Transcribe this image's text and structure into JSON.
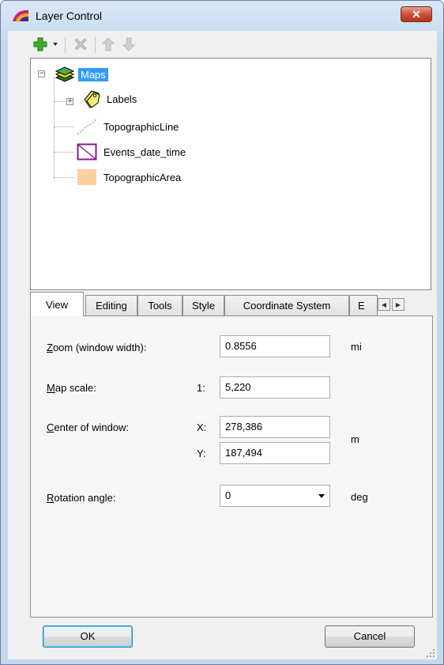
{
  "window": {
    "title": "Layer Control",
    "close_glyph": "✕"
  },
  "toolbar": {
    "add_icon": "plus-icon",
    "remove_icon": "delete-x-icon",
    "up_icon": "arrow-up-icon",
    "down_icon": "arrow-down-icon"
  },
  "tree": {
    "root": {
      "label": "Maps",
      "expander": "−"
    },
    "items": [
      {
        "label": "Labels",
        "expander": "+"
      },
      {
        "label": "TopographicLine"
      },
      {
        "label": "Events_date_time"
      },
      {
        "label": "TopographicArea"
      }
    ]
  },
  "tabs": [
    "View",
    "Editing",
    "Tools",
    "Style",
    "Coordinate System",
    "E"
  ],
  "view_panel": {
    "zoom": {
      "label_key": "Z",
      "label_rest": "oom (window width):",
      "value": "0.8556",
      "unit": "mi"
    },
    "scale": {
      "label_key": "M",
      "label_rest": "ap scale:",
      "prefix": "1:",
      "value": "5,220"
    },
    "center": {
      "label_key": "C",
      "label_rest": "enter of window:",
      "x_prefix": "X:",
      "x_value": "278,386",
      "y_prefix": "Y:",
      "y_value": "187,494",
      "unit": "m"
    },
    "rotation": {
      "label_key": "R",
      "label_rest": "otation angle:",
      "value": "0",
      "unit": "deg"
    }
  },
  "buttons": {
    "ok": "OK",
    "cancel": "Cancel"
  },
  "colors": {
    "selection": "#3399ff",
    "add_green": "#3fae29",
    "topographic_area": "#fbcf9f",
    "events_border": "#8a1a8a"
  }
}
